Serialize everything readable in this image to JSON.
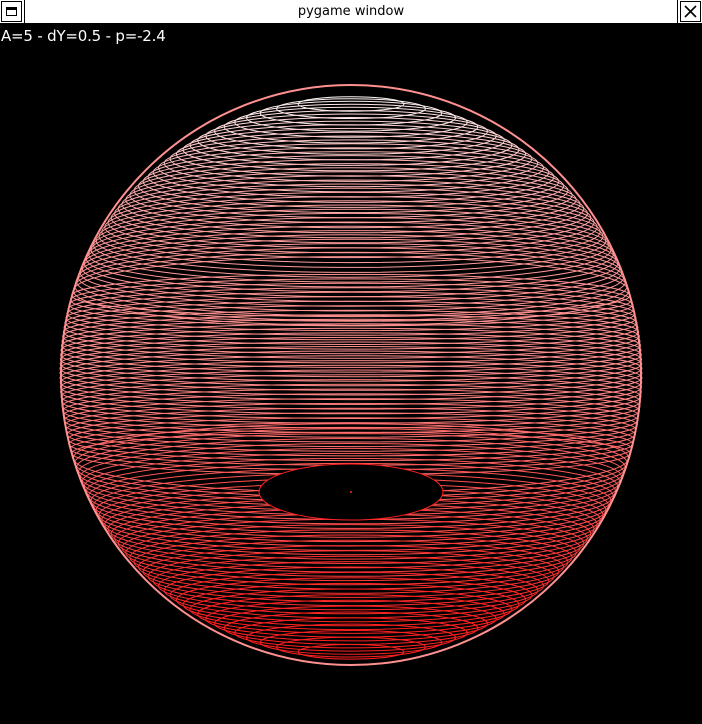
{
  "window": {
    "title": "pygame window",
    "menu_icon": "window-menu-icon",
    "close_icon": "close-icon"
  },
  "overlay": {
    "status_text": "A=5 - dY=0.5 - p=-2.4"
  },
  "render": {
    "background": "#000000",
    "ring_color_near": "#ff2020",
    "ring_color_far": "#ff9090",
    "highlight_color": "#ffffff"
  }
}
